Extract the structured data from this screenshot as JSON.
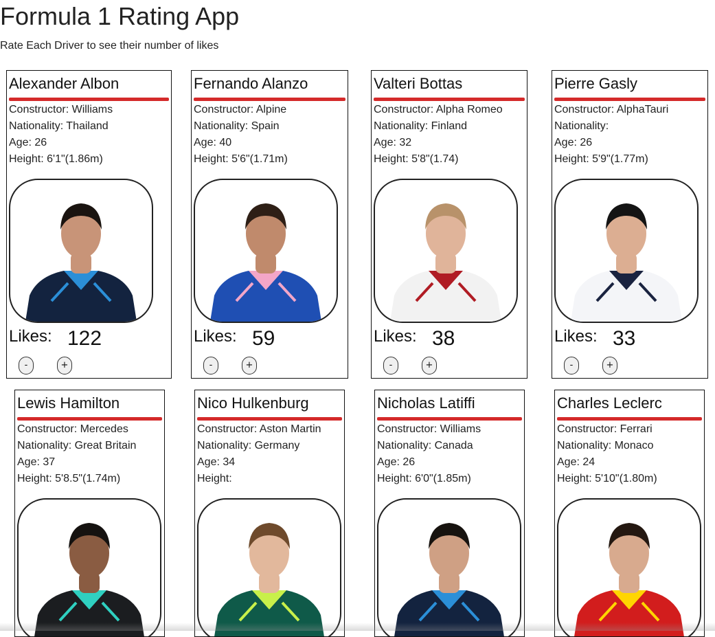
{
  "app": {
    "title": "Formula 1 Rating App",
    "subtitle": "Rate Each Driver to see their number of likes"
  },
  "labels": {
    "likes": "Likes:",
    "decrement": "-",
    "increment": "+"
  },
  "colors": {
    "accent_bar": "#d42a2a",
    "card_border": "#111111"
  },
  "drivers": [
    {
      "name": "Alexander Albon",
      "constructor": "Constructor: Williams",
      "nationality": "Nationality: Thailand",
      "age": "Age: 26",
      "height": "Height: 6'1\"(1.86m)",
      "likes": "122",
      "suit": "williams"
    },
    {
      "name": "Fernando Alanzo",
      "constructor": "Constructor: Alpine",
      "nationality": "Nationality: Spain",
      "age": "Age: 40",
      "height": "Height: 5'6\"(1.71m)",
      "likes": "59",
      "suit": "alpine"
    },
    {
      "name": "Valteri Bottas",
      "constructor": "Constructor: Alpha Romeo",
      "nationality": "Nationality: Finland",
      "age": "Age: 32",
      "height": "Height: 5'8\"(1.74)",
      "likes": "38",
      "suit": "alfa-romeo"
    },
    {
      "name": "Pierre Gasly",
      "constructor": "Constructor: AlphaTauri",
      "nationality": "Nationality:",
      "age": "Age: 26",
      "height": "Height: 5'9\"(1.77m)",
      "likes": "33",
      "suit": "alphatauri"
    },
    {
      "name": "Lewis Hamilton",
      "constructor": "Constructor: Mercedes",
      "nationality": "Nationality: Great Britain",
      "age": "Age: 37",
      "height": "Height: 5'8.5\"(1.74m)",
      "likes": "",
      "suit": "mercedes"
    },
    {
      "name": "Nico Hulkenburg",
      "constructor": "Constructor: Aston Martin",
      "nationality": "Nationality: Germany",
      "age": "Age: 34",
      "height": "Height:",
      "likes": "",
      "suit": "aston-martin"
    },
    {
      "name": "Nicholas Latiffi",
      "constructor": "Constructor: Williams",
      "nationality": "Nationality: Canada",
      "age": "Age: 26",
      "height": "Height: 6'0\"(1.85m)",
      "likes": "",
      "suit": "williams"
    },
    {
      "name": "Charles Leclerc",
      "constructor": "Constructor: Ferrari",
      "nationality": "Nationality: Monaco",
      "age": "Age: 24",
      "height": "Height: 5'10\"(1.80m)",
      "likes": "",
      "suit": "ferrari"
    }
  ]
}
